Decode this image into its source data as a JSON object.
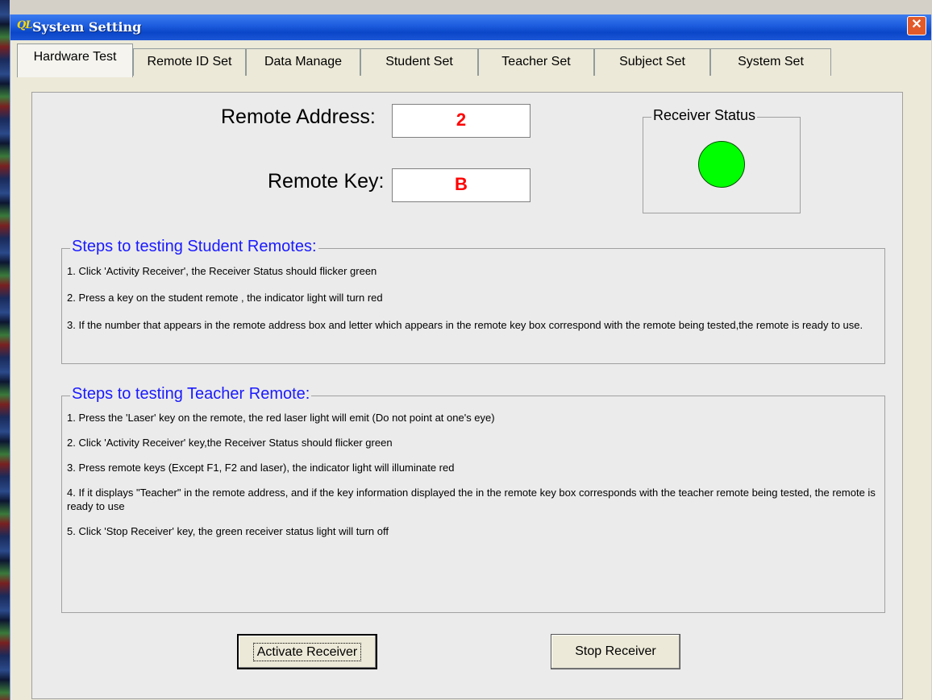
{
  "window": {
    "logo": "QL",
    "title": "System Setting",
    "close": "✕"
  },
  "tabs": [
    {
      "label": "Hardware Test"
    },
    {
      "label": "Remote ID Set"
    },
    {
      "label": "Data Manage"
    },
    {
      "label": "Student Set"
    },
    {
      "label": "Teacher Set"
    },
    {
      "label": "Subject Set"
    },
    {
      "label": "System Set"
    }
  ],
  "remote": {
    "address_label": "Remote Address:",
    "address_value": "2",
    "key_label": "Remote Key:",
    "key_value": "B"
  },
  "receiver": {
    "label": "Receiver Status",
    "color": "#00ff00"
  },
  "student_steps": {
    "title": "Steps to testing Student Remotes:",
    "items": [
      "1. Click 'Activity Receiver', the Receiver Status should flicker green",
      "2. Press a key on the student remote , the indicator light will turn red",
      "3. If the number that appears in the remote address box and letter which appears in the remote key box correspond with the remote being tested,the remote is ready to use."
    ]
  },
  "teacher_steps": {
    "title": "Steps to testing Teacher Remote:",
    "items": [
      "1. Press the 'Laser' key on the remote, the red laser light will emit (Do not point at one's eye)",
      "2. Click 'Activity Receiver' key,the Receiver Status should flicker green",
      "3. Press remote keys (Except F1, F2 and laser), the indicator light will illuminate red",
      "4. If it displays \"Teacher\" in the remote address, and if the key information displayed the in the remote key box corresponds with the teacher remote being tested, the remote is ready to use",
      "5. Click 'Stop Receiver' key, the green receiver status light will turn off"
    ]
  },
  "buttons": {
    "activate": "Activate Receiver",
    "stop": "Stop Receiver"
  },
  "colors": {
    "title_bar": "#0a46c8",
    "heading": "#1a1aff",
    "value_text": "#ff0000"
  }
}
